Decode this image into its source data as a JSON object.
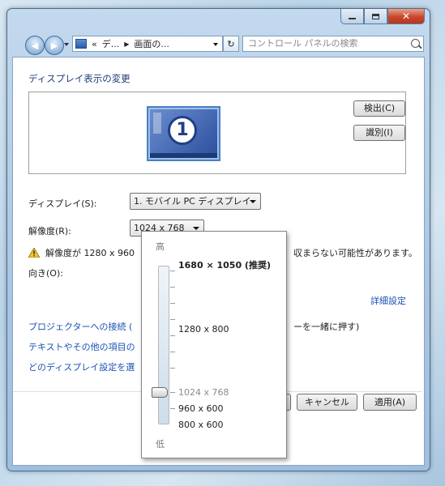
{
  "window": {
    "caption_buttons": {
      "minimize": "minimize-icon",
      "maximize": "maximize-icon",
      "close": "close-icon"
    },
    "breadcrumb": {
      "prefix": "«",
      "part1": "デ...",
      "part2": "画面の..."
    },
    "search_placeholder": "コントロール パネルの検索"
  },
  "page": {
    "title": "ディスプレイ表示の変更",
    "monitor_number": "1",
    "detect_button": "検出(C)",
    "identify_button": "識別(I)",
    "display_label": "ディスプレイ(S):",
    "display_value": "1. モバイル PC ディスプレイ",
    "resolution_label": "解像度(R):",
    "resolution_value": "1024 x 768",
    "warning_left": "解像度が 1280 x 960",
    "warning_right": "収まらない可能性があります。",
    "orientation_label": "向き(O):",
    "advanced_link": "詳細設定",
    "link1_left": "プロジェクターへの接続 (",
    "link1_right": "ーを一緒に押す)",
    "link2": "テキストやその他の項目の",
    "link3": "どのディスプレイ設定を選",
    "ok_fragment": "",
    "cancel_button": "キャンセル",
    "apply_button": "適用(A)"
  },
  "resolution_dropdown": {
    "high_label": "高",
    "low_label": "低",
    "options": [
      "1680 × 1050 (推奨)",
      "1280 x 800",
      "1024 x 768",
      "960 x 600",
      "800 x 600"
    ],
    "selected": "1024 x 768",
    "slider_level": 0.17
  },
  "colors": {
    "link": "#1a52b3",
    "title": "#1e3b7a"
  }
}
